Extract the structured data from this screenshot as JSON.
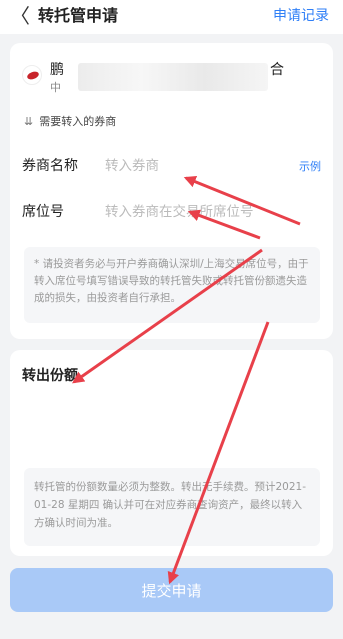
{
  "header": {
    "back_icon": "chevron-left-icon",
    "back_glyph": "〈",
    "title": "转托管申请",
    "record_link": "申请记录"
  },
  "fund": {
    "name_start": "鹏",
    "name_end": "合",
    "code_start": "中"
  },
  "section_hint": {
    "arrow": "⇊",
    "text": "需要转入的券商"
  },
  "broker": {
    "label": "券商名称",
    "placeholder": "转入券商",
    "example_link": "示例"
  },
  "seat": {
    "label": "席位号",
    "placeholder": "转入券商在交易所席位号"
  },
  "notice1": "* 请投资者务必与开户券商确认深圳/上海交易席位号，由于转入席位号填写错误导致的转托管失败或转托管份额遗失造成的损失，由投资者自行承担。",
  "out_share": {
    "label": "转出份额",
    "value": ""
  },
  "notice2": "转托管的份额数量必须为整数。转出无手续费。预计2021-01-28 星期四 确认并可在对应券商查询资产，最终以转入方确认时间为准。",
  "submit_label": "提交申请",
  "colors": {
    "accent": "#2f7ff7",
    "submit_disabled": "#a9c9f7",
    "annotation_arrow": "#e8404a",
    "logo_red": "#c8242b"
  }
}
